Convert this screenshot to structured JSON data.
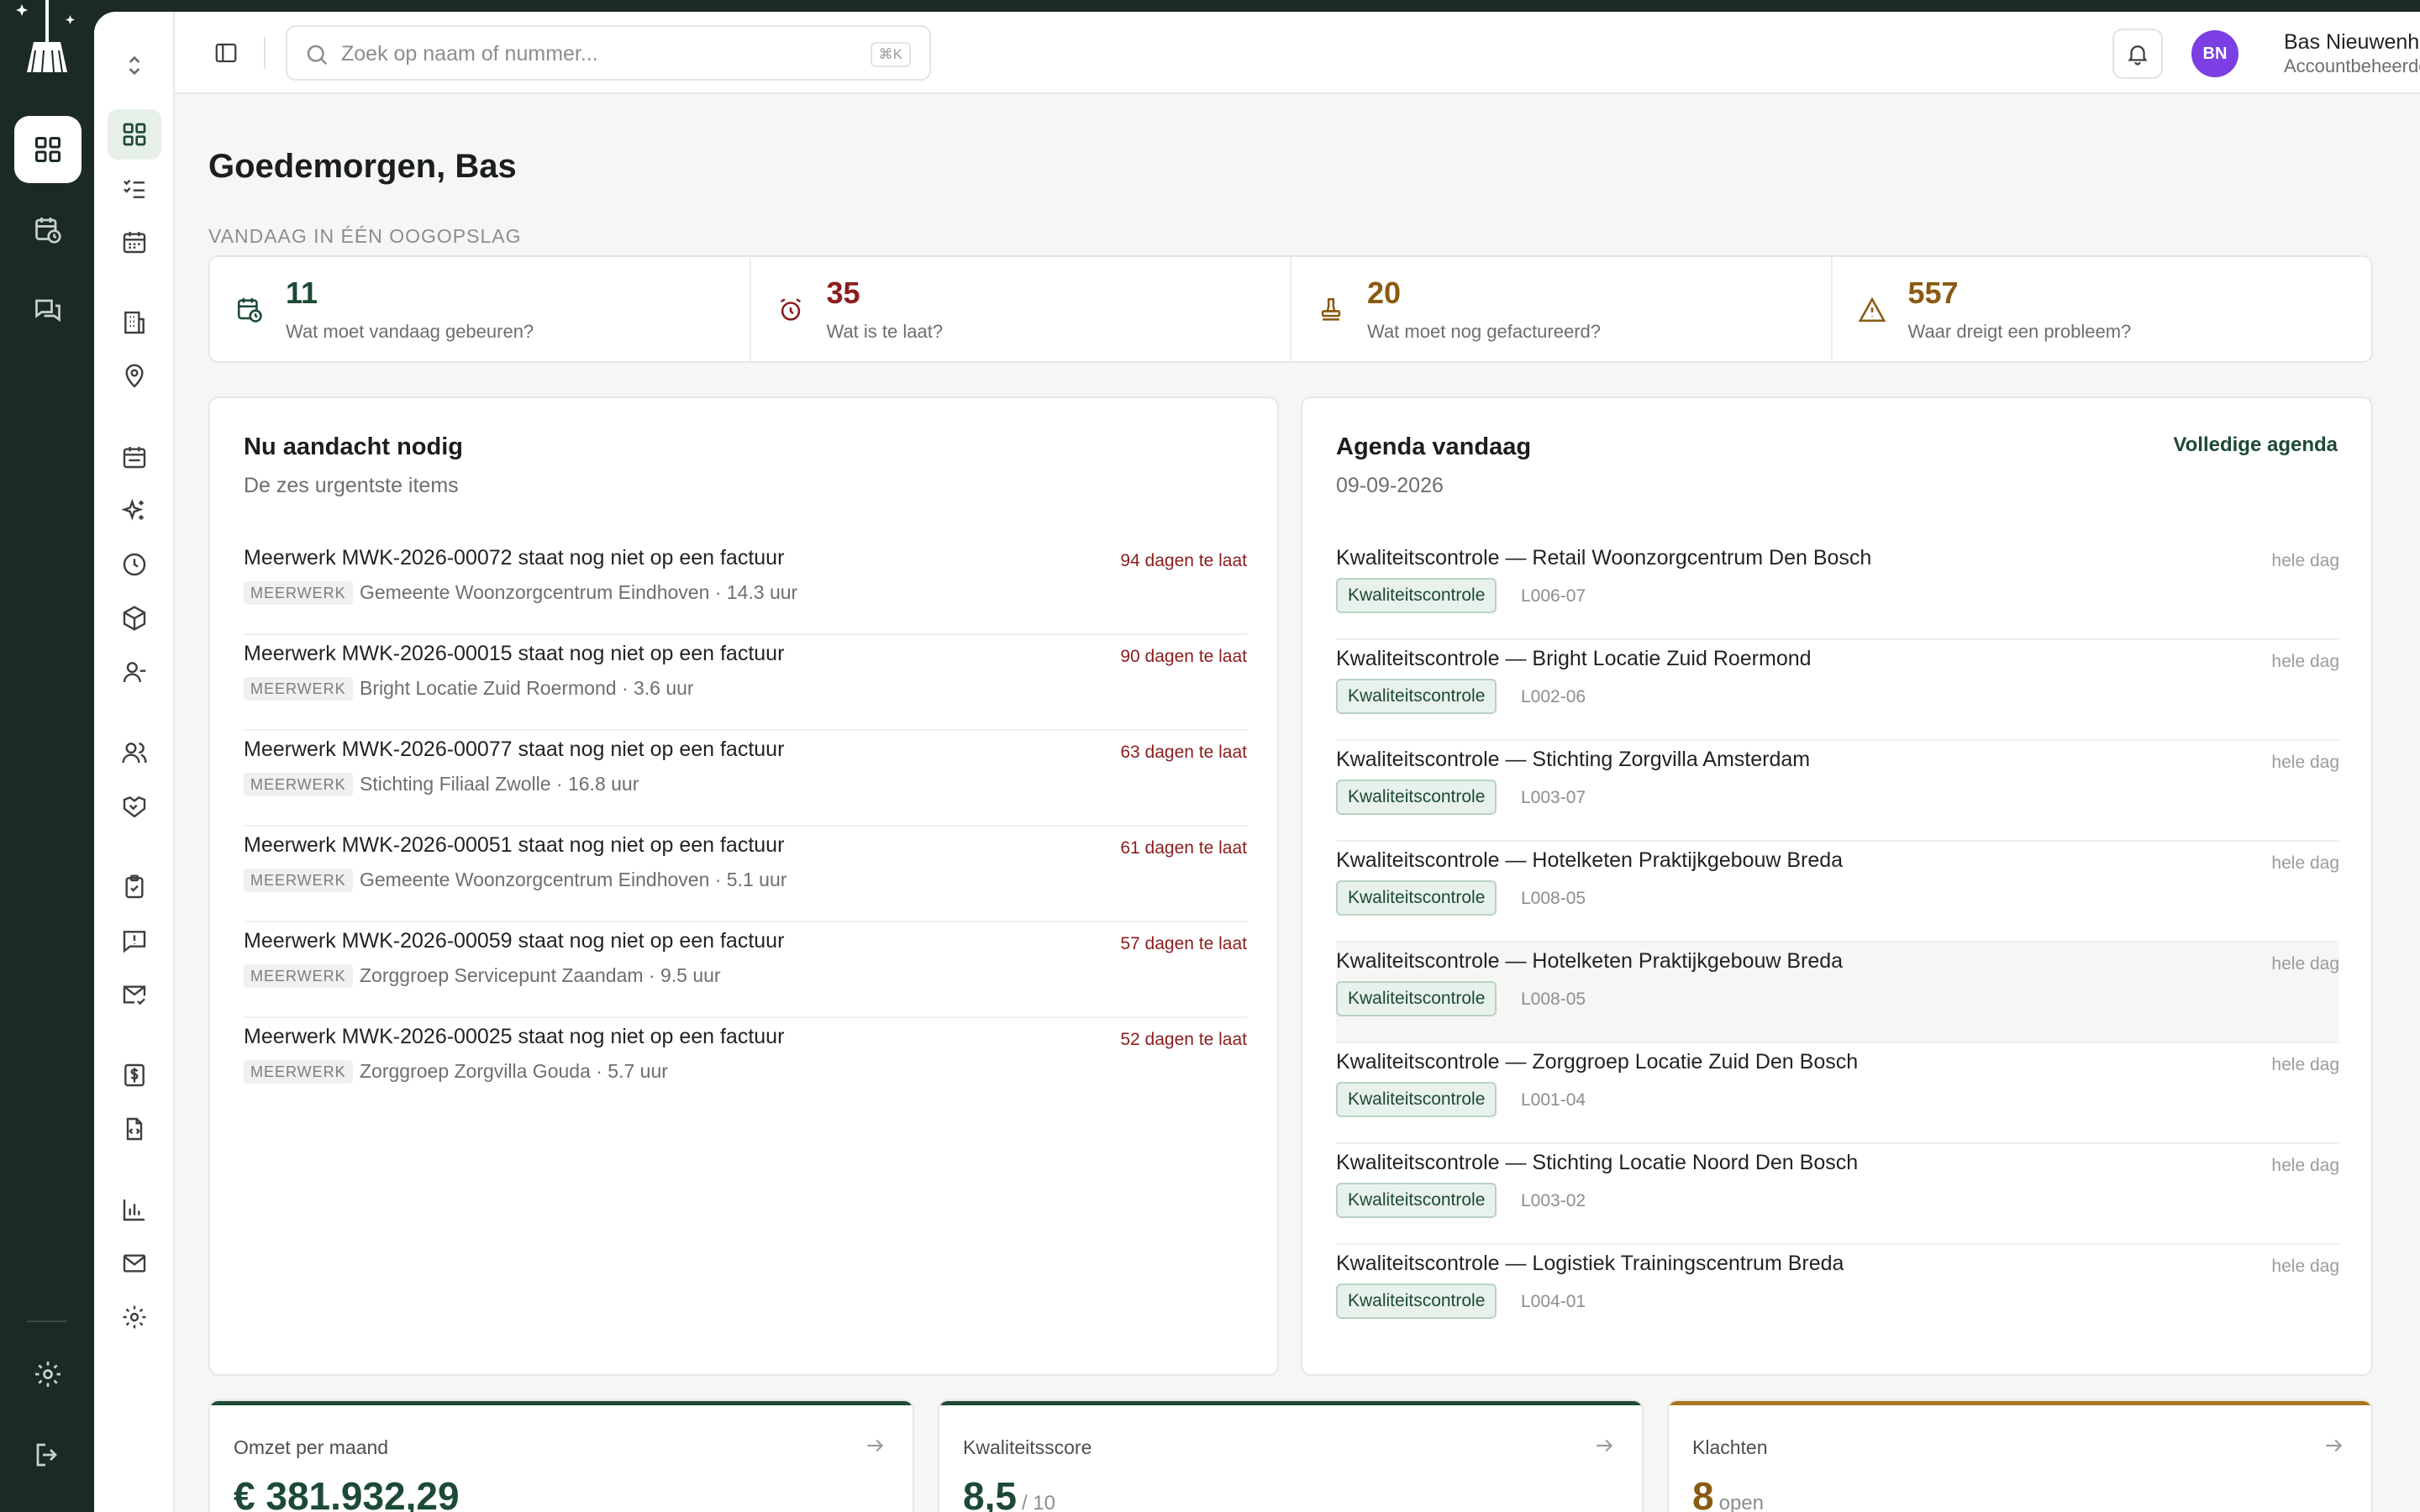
{
  "app": {
    "brand_color": "#1b2b24",
    "accent_color": "#1d4a34"
  },
  "rail": {
    "items": [
      {
        "icon": "dashboard-icon",
        "active": true
      },
      {
        "icon": "calendar-clock-icon",
        "active": false
      },
      {
        "icon": "chat-icon",
        "active": false
      }
    ],
    "bottom": [
      {
        "icon": "settings-icon"
      },
      {
        "icon": "logout-icon"
      }
    ]
  },
  "sidebar": {
    "items": [
      {
        "icon": "dashboard-icon",
        "active": true
      },
      {
        "icon": "checklist-icon"
      },
      {
        "icon": "calendar-icon"
      },
      {
        "icon": "building-icon"
      },
      {
        "icon": "location-pin-icon"
      },
      {
        "icon": "calendar-days-icon"
      },
      {
        "icon": "sparkle-icon"
      },
      {
        "icon": "clock-icon"
      },
      {
        "icon": "package-icon"
      },
      {
        "icon": "user-minus-icon"
      },
      {
        "icon": "users-icon"
      },
      {
        "icon": "handshake-icon"
      },
      {
        "icon": "clipboard-check-icon"
      },
      {
        "icon": "message-alert-icon"
      },
      {
        "icon": "mail-check-icon"
      },
      {
        "icon": "invoice-icon"
      },
      {
        "icon": "file-code-icon"
      },
      {
        "icon": "bar-chart-icon"
      },
      {
        "icon": "mail-icon"
      },
      {
        "icon": "gear-icon"
      }
    ]
  },
  "topbar": {
    "search_placeholder": "Zoek op naam of nummer...",
    "search_shortcut": "⌘K",
    "user": {
      "initials": "BN",
      "name": "Bas Nieuwenhuis",
      "role": "Accountbeheerder",
      "avatar_color": "#7b3fe4"
    }
  },
  "main": {
    "greeting": "Goedemorgen, Bas",
    "overview_label": "VANDAAG IN ÉÉN OOGOPSLAG",
    "kpis": [
      {
        "value": "11",
        "label": "Wat moet vandaag gebeuren?",
        "icon": "calendar-clock-icon",
        "color": "#1d4a34"
      },
      {
        "value": "35",
        "label": "Wat is te laat?",
        "icon": "alarm-clock-icon",
        "color": "#8a1d1d"
      },
      {
        "value": "20",
        "label": "Wat moet nog gefactureerd?",
        "icon": "stamp-icon",
        "color": "#8a5a12"
      },
      {
        "value": "557",
        "label": "Waar dreigt een probleem?",
        "icon": "warning-icon",
        "color": "#8a5a12"
      }
    ],
    "attention": {
      "title": "Nu aandacht nodig",
      "subtitle": "De zes urgentste items",
      "items": [
        {
          "title": "Meerwerk MWK-2026-00072 staat nog niet op een factuur",
          "tag": "MEERWERK",
          "meta": "Gemeente Woonzorgcentrum Eindhoven · 14.3 uur",
          "late": "94 dagen te laat"
        },
        {
          "title": "Meerwerk MWK-2026-00015 staat nog niet op een factuur",
          "tag": "MEERWERK",
          "meta": "Bright Locatie Zuid Roermond · 3.6 uur",
          "late": "90 dagen te laat"
        },
        {
          "title": "Meerwerk MWK-2026-00077 staat nog niet op een factuur",
          "tag": "MEERWERK",
          "meta": "Stichting Filiaal Zwolle · 16.8 uur",
          "late": "63 dagen te laat"
        },
        {
          "title": "Meerwerk MWK-2026-00051 staat nog niet op een factuur",
          "tag": "MEERWERK",
          "meta": "Gemeente Woonzorgcentrum Eindhoven · 5.1 uur",
          "late": "61 dagen te laat"
        },
        {
          "title": "Meerwerk MWK-2026-00059 staat nog niet op een factuur",
          "tag": "MEERWERK",
          "meta": "Zorggroep Servicepunt Zaandam · 9.5 uur",
          "late": "57 dagen te laat"
        },
        {
          "title": "Meerwerk MWK-2026-00025 staat nog niet op een factuur",
          "tag": "MEERWERK",
          "meta": "Zorggroep Zorgvilla Gouda · 5.7 uur",
          "late": "52 dagen te laat"
        }
      ]
    },
    "agenda": {
      "title": "Agenda vandaag",
      "date": "09-09-2026",
      "link": "Volledige agenda",
      "items": [
        {
          "title": "Kwaliteitscontrole — Retail Woonzorgcentrum Den Bosch",
          "tag": "Kwaliteitscontrole",
          "code": "L006-07",
          "time": "hele dag"
        },
        {
          "title": "Kwaliteitscontrole — Bright Locatie Zuid Roermond",
          "tag": "Kwaliteitscontrole",
          "code": "L002-06",
          "time": "hele dag"
        },
        {
          "title": "Kwaliteitscontrole — Stichting Zorgvilla Amsterdam",
          "tag": "Kwaliteitscontrole",
          "code": "L003-07",
          "time": "hele dag"
        },
        {
          "title": "Kwaliteitscontrole — Hotelketen Praktijkgebouw Breda",
          "tag": "Kwaliteitscontrole",
          "code": "L008-05",
          "time": "hele dag"
        },
        {
          "title": "Kwaliteitscontrole — Hotelketen Praktijkgebouw Breda",
          "tag": "Kwaliteitscontrole",
          "code": "L008-05",
          "time": "hele dag"
        },
        {
          "title": "Kwaliteitscontrole — Zorggroep Locatie Zuid Den Bosch",
          "tag": "Kwaliteitscontrole",
          "code": "L001-04",
          "time": "hele dag"
        },
        {
          "title": "Kwaliteitscontrole — Stichting Locatie Noord Den Bosch",
          "tag": "Kwaliteitscontrole",
          "code": "L003-02",
          "time": "hele dag"
        },
        {
          "title": "Kwaliteitscontrole — Logistiek Trainingscentrum Breda",
          "tag": "Kwaliteitscontrole",
          "code": "L004-01",
          "time": "hele dag"
        }
      ]
    },
    "cards": [
      {
        "label": "Omzet per maand",
        "value": "€ 381.932,29",
        "suffix": "",
        "color": "#1d4a34"
      },
      {
        "label": "Kwaliteitsscore",
        "value": "8,5",
        "suffix": "/ 10",
        "color": "#1d4a34"
      },
      {
        "label": "Klachten",
        "value": "8",
        "suffix": "open",
        "color": "#8a5a12"
      }
    ]
  }
}
